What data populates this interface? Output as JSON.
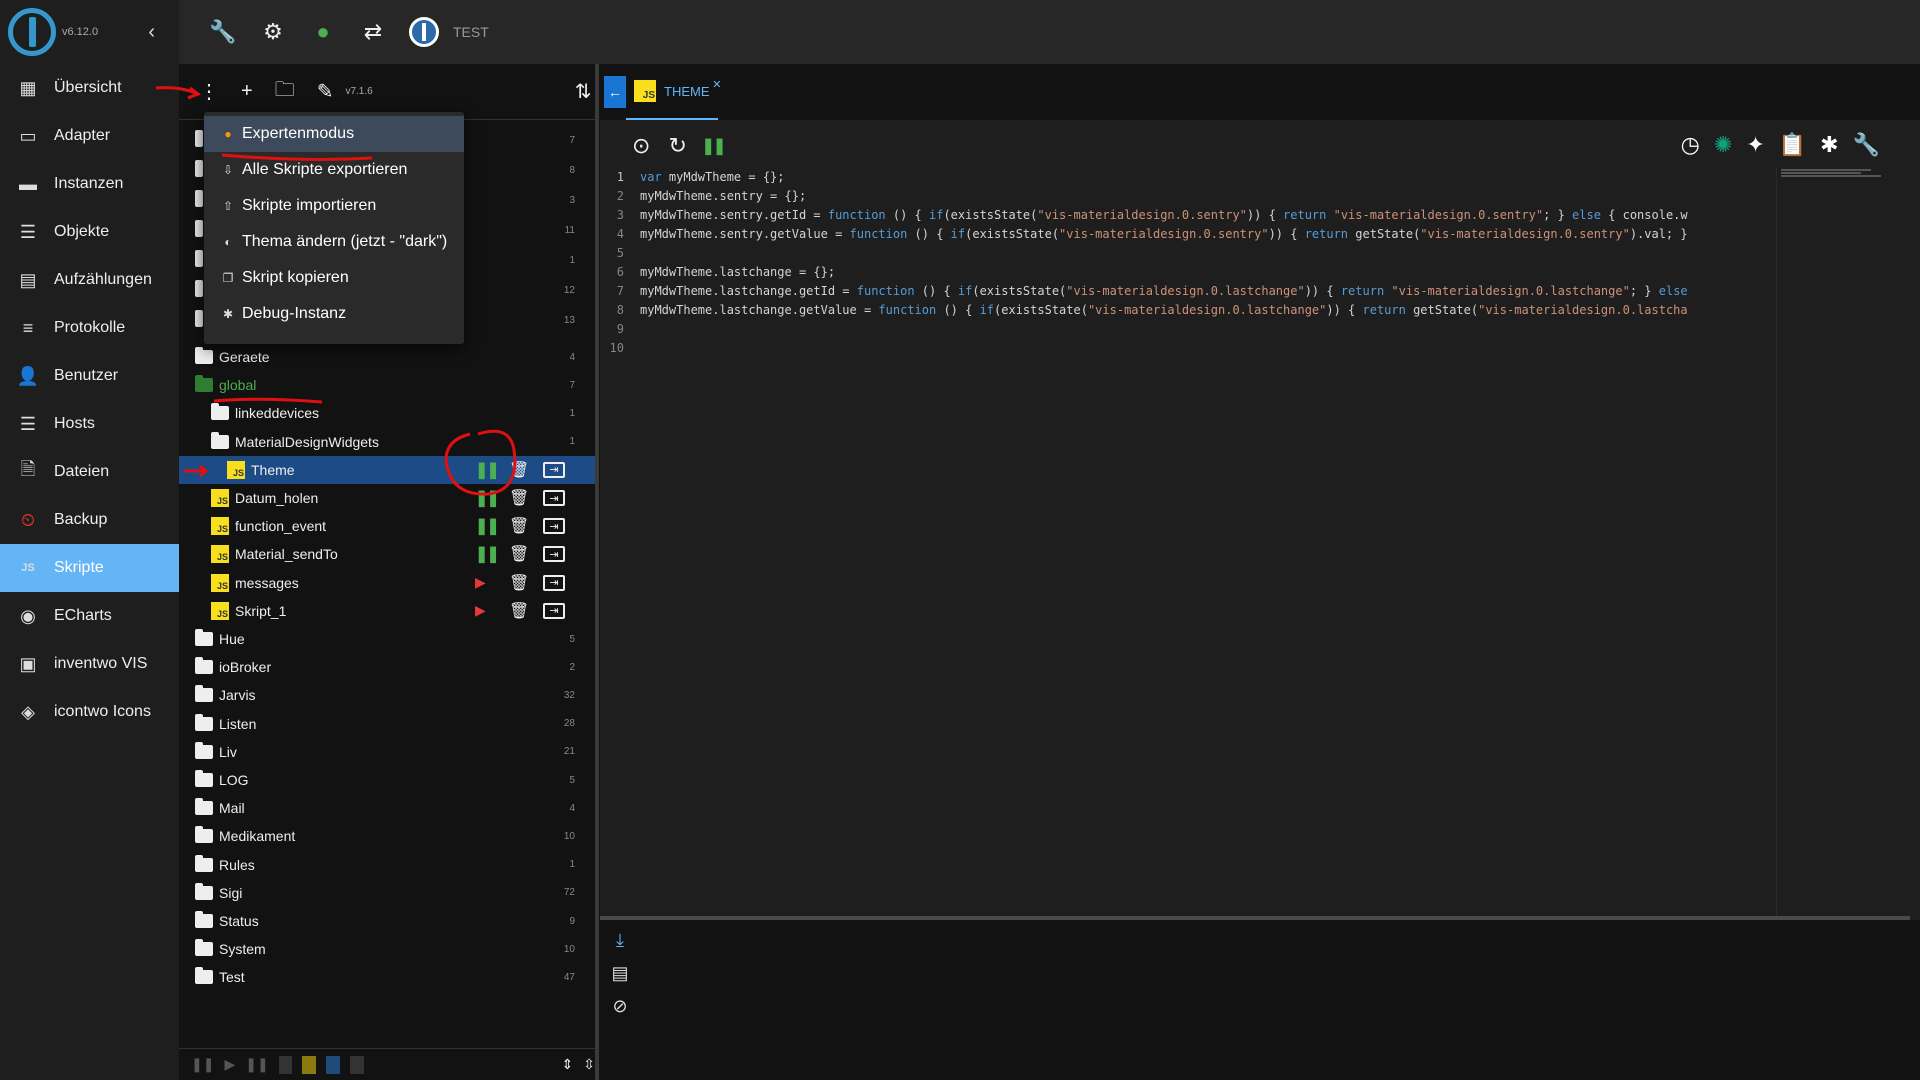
{
  "app": {
    "version": "v6.12.0",
    "instance_label": "TEST"
  },
  "nav": {
    "items": [
      {
        "label": "Übersicht",
        "icon": "grid-icon"
      },
      {
        "label": "Adapter",
        "icon": "store-icon"
      },
      {
        "label": "Instanzen",
        "icon": "instances-icon"
      },
      {
        "label": "Objekte",
        "icon": "list-icon"
      },
      {
        "label": "Aufzählungen",
        "icon": "enum-icon"
      },
      {
        "label": "Protokolle",
        "icon": "log-icon"
      },
      {
        "label": "Benutzer",
        "icon": "user-icon"
      },
      {
        "label": "Hosts",
        "icon": "hosts-icon"
      },
      {
        "label": "Dateien",
        "icon": "files-icon"
      },
      {
        "label": "Backup",
        "icon": "backup-icon"
      },
      {
        "label": "Skripte",
        "icon": "js-icon",
        "active": true
      },
      {
        "label": "ECharts",
        "icon": "echarts-icon"
      },
      {
        "label": "inventwo VIS",
        "icon": "inventwo-icon"
      },
      {
        "label": "icontwo Icons",
        "icon": "icontwo-icon"
      }
    ]
  },
  "tree_toolbar": {
    "version": "v7.1.6"
  },
  "menu": {
    "items": [
      {
        "label": "Expertenmodus",
        "highlighted": true
      },
      {
        "label": "Alle Skripte exportieren"
      },
      {
        "label": "Skripte importieren"
      },
      {
        "label": "Thema ändern (jetzt - \"dark\")"
      },
      {
        "label": "Skript kopieren"
      },
      {
        "label": "Debug-Instanz"
      }
    ]
  },
  "tree": {
    "hidden_counts": [
      "7",
      "8",
      "3",
      "11",
      "1",
      "12",
      "13"
    ],
    "rows": [
      {
        "label": "Geraete",
        "type": "folder",
        "count": "4"
      },
      {
        "label": "global",
        "type": "folder-open-green",
        "count": "7"
      },
      {
        "label": "linkeddevices",
        "type": "folder",
        "count": "1",
        "indent": 1
      },
      {
        "label": "MaterialDesignWidgets",
        "type": "folder-open",
        "count": "1",
        "indent": 1
      },
      {
        "label": "Theme",
        "type": "js",
        "indent": 2,
        "state": "running",
        "selected": true
      },
      {
        "label": "Datum_holen",
        "type": "js",
        "indent": 1,
        "state": "running"
      },
      {
        "label": "function_event",
        "type": "js",
        "indent": 1,
        "state": "running"
      },
      {
        "label": "Material_sendTo",
        "type": "js",
        "indent": 1,
        "state": "running"
      },
      {
        "label": "messages",
        "type": "js",
        "indent": 1,
        "state": "stopped"
      },
      {
        "label": "Skript_1",
        "type": "js",
        "indent": 1,
        "state": "stopped"
      },
      {
        "label": "Hue",
        "type": "folder",
        "count": "5"
      },
      {
        "label": "ioBroker",
        "type": "folder",
        "count": "2"
      },
      {
        "label": "Jarvis",
        "type": "folder",
        "count": "32"
      },
      {
        "label": "Listen",
        "type": "folder",
        "count": "28"
      },
      {
        "label": "Liv",
        "type": "folder",
        "count": "21"
      },
      {
        "label": "LOG",
        "type": "folder",
        "count": "5"
      },
      {
        "label": "Mail",
        "type": "folder",
        "count": "4"
      },
      {
        "label": "Medikament",
        "type": "folder",
        "count": "10"
      },
      {
        "label": "Rules",
        "type": "folder",
        "count": "1"
      },
      {
        "label": "Sigi",
        "type": "folder",
        "count": "72"
      },
      {
        "label": "Status",
        "type": "folder",
        "count": "9"
      },
      {
        "label": "System",
        "type": "folder",
        "count": "10"
      },
      {
        "label": "Test",
        "type": "folder",
        "count": "47"
      }
    ]
  },
  "editor": {
    "tab_label": "THEME",
    "lines": [
      "var myMdwTheme = {};",
      "myMdwTheme.sentry = {};",
      "myMdwTheme.sentry.getId = function () { if(existsState(\"vis-materialdesign.0.sentry\")) { return \"vis-materialdesign.0.sentry\"; } else { console.w",
      "myMdwTheme.sentry.getValue = function () { if(existsState(\"vis-materialdesign.0.sentry\")) { return getState(\"vis-materialdesign.0.sentry\").val; }",
      "",
      "myMdwTheme.lastchange = {};",
      "myMdwTheme.lastchange.getId = function () { if(existsState(\"vis-materialdesign.0.lastchange\")) { return \"vis-materialdesign.0.lastchange\"; } else",
      "myMdwTheme.lastchange.getValue = function () { if(existsState(\"vis-materialdesign.0.lastchange\")) { return getState(\"vis-materialdesign.0.lastcha",
      "",
      ""
    ]
  },
  "colors": {
    "accent": "#64b5f6",
    "selected": "#1c4b86",
    "running": "#4caf50",
    "stopped": "#e53935",
    "js": "#f7df1e"
  }
}
